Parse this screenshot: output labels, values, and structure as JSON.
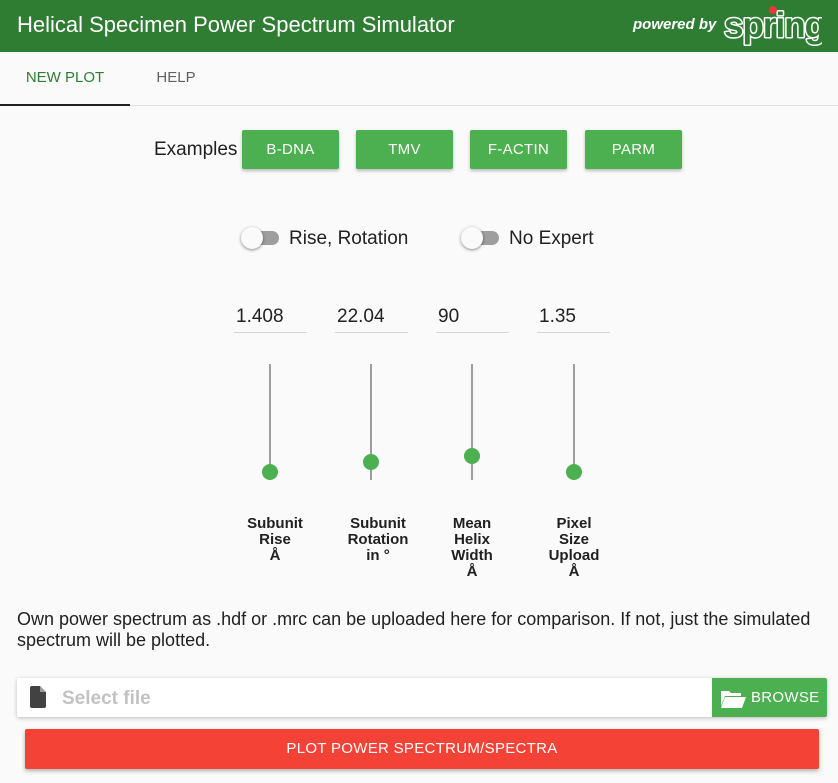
{
  "header": {
    "title": "Helical Specimen Power Spectrum Simulator",
    "powered_by": "powered by",
    "logo_text": "spring"
  },
  "tabs": [
    {
      "label": "NEW PLOT",
      "active": true
    },
    {
      "label": "HELP",
      "active": false
    }
  ],
  "examples": {
    "label": "Examples",
    "buttons": [
      "B-DNA",
      "TMV",
      "F-ACTIN",
      "PARM"
    ]
  },
  "toggles": [
    {
      "label": "Rise, Rotation",
      "on": false
    },
    {
      "label": "No Expert",
      "on": false
    }
  ],
  "sliders": [
    {
      "value": "1.408",
      "label": [
        "Subunit",
        "Rise",
        "Å"
      ],
      "level": 0.0
    },
    {
      "value": "22.04",
      "label": [
        "Subunit",
        "Rotation",
        "in °"
      ],
      "level": 0.1
    },
    {
      "value": "90",
      "label": [
        "Mean",
        "Helix",
        "Width",
        "Å"
      ],
      "level": 0.16
    },
    {
      "value": "1.35",
      "label": [
        "Pixel",
        "Size",
        "Upload",
        "Å"
      ],
      "level": 0.0
    }
  ],
  "upload": {
    "info": "Own power spectrum as .hdf or .mrc can be uploaded here for comparison. If not, just the simulated spectrum will be plotted.",
    "placeholder": "Select file",
    "browse_label": "BROWSE"
  },
  "plot_button": "PLOT POWER SPECTRUM/SPECTRA",
  "colors": {
    "header": "#2e7d32",
    "accent": "#4caf50",
    "plot_button": "#f44336",
    "logo_dot": "#e53935"
  }
}
